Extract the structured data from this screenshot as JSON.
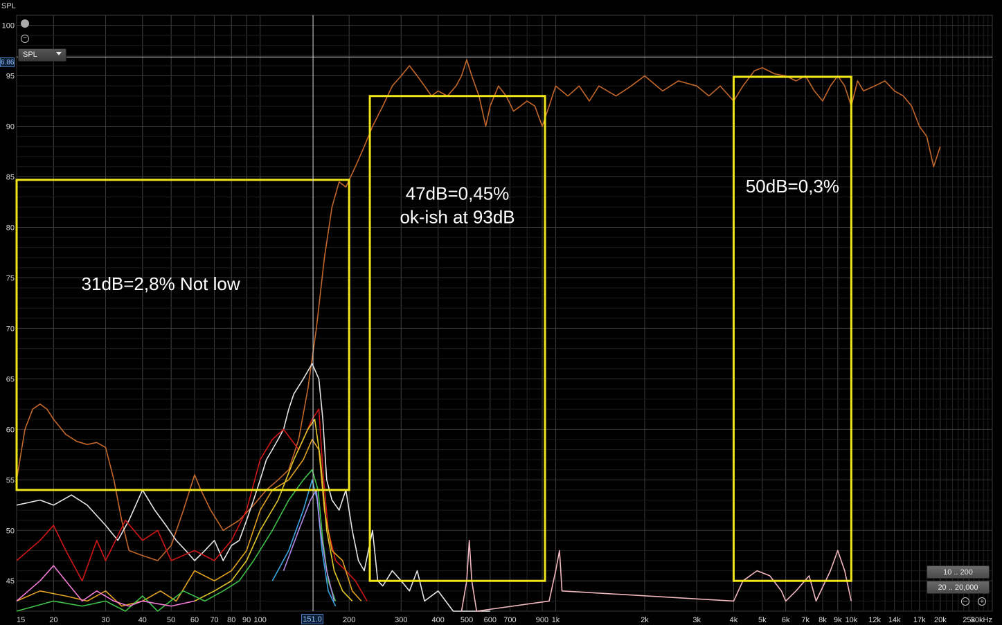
{
  "window": {
    "axis_title": "SPL"
  },
  "controls": {
    "dropdown_value": "SPL",
    "range_buttons": [
      "10 .. 200",
      "20 .. 20,000"
    ],
    "zoom_out_symbol": "−",
    "zoom_in_symbol": "+"
  },
  "cursor": {
    "y_readout": "6.86",
    "x_readout": "151.0",
    "x_value": 151.0,
    "y_value": 96.86
  },
  "annotations": [
    {
      "text_lines": [
        "31dB=2,8% Not low"
      ],
      "x_range": [
        15,
        200
      ],
      "y_range": [
        54,
        84.7
      ]
    },
    {
      "text_lines": [
        "47dB=0,45%",
        "ok-ish at 93dB"
      ],
      "x_range": [
        235,
        920
      ],
      "y_range": [
        45,
        93
      ]
    },
    {
      "text_lines": [
        "50dB=0,3%"
      ],
      "x_range": [
        4000,
        10000
      ],
      "y_range": [
        45,
        94.9
      ]
    }
  ],
  "colors": {
    "background": "#000000",
    "grid": "#3a3a3a",
    "highlight_box": "#f0e51a",
    "fundamental": "#c4672a",
    "total_distortion": "#e6e6e6",
    "h2": "#d01616",
    "h3": "#e3a21f",
    "h4": "#e4c92a",
    "h5": "#3ec24a",
    "h6": "#f07ad6",
    "h7": "#39a6e0",
    "h8": "#b08ae6",
    "h9": "#f2b8c0"
  },
  "chart_data": {
    "type": "line",
    "xscale": "log",
    "xlim": [
      15,
      30000
    ],
    "ylim": [
      42,
      101
    ],
    "xlabel": "",
    "ylabel": "SPL",
    "x_ticks": [
      15,
      20,
      30,
      40,
      50,
      60,
      70,
      80,
      90,
      100,
      200,
      300,
      400,
      500,
      600,
      700,
      900,
      1000,
      2000,
      3000,
      4000,
      5000,
      6000,
      7000,
      8000,
      9000,
      10000,
      12000,
      14000,
      17000,
      20000,
      25000,
      30000
    ],
    "x_tick_labels": [
      "15",
      "20",
      "30",
      "40",
      "50",
      "60",
      "70",
      "80",
      "90",
      "100",
      "200",
      "300",
      "400",
      "500",
      "600",
      "700",
      "900",
      "1k",
      "2k",
      "3k",
      "4k",
      "5k",
      "6k",
      "7k",
      "8k",
      "9k",
      "10k",
      "12k",
      "14k",
      "17k",
      "20k",
      "25k",
      "30kHz"
    ],
    "y_ticks": [
      45,
      50,
      55,
      60,
      65,
      70,
      75,
      80,
      85,
      90,
      95,
      100
    ],
    "grid": true,
    "series": [
      {
        "color_key": "fundamental",
        "points": [
          [
            15,
            55
          ],
          [
            16,
            60
          ],
          [
            17,
            62
          ],
          [
            18,
            62.5
          ],
          [
            19,
            62
          ],
          [
            20,
            61
          ],
          [
            22,
            59.5
          ],
          [
            24,
            58.8
          ],
          [
            26,
            58.5
          ],
          [
            28,
            58.7
          ],
          [
            30,
            58.2
          ],
          [
            32,
            55
          ],
          [
            34,
            51
          ],
          [
            36,
            48
          ],
          [
            40,
            47.5
          ],
          [
            45,
            47
          ],
          [
            50,
            48.5
          ],
          [
            55,
            52
          ],
          [
            60,
            55.5
          ],
          [
            63,
            54
          ],
          [
            68,
            52
          ],
          [
            75,
            50
          ],
          [
            85,
            51
          ],
          [
            95,
            52.5
          ],
          [
            105,
            54
          ],
          [
            115,
            55
          ],
          [
            125,
            56
          ],
          [
            135,
            59
          ],
          [
            145,
            64
          ],
          [
            155,
            70
          ],
          [
            165,
            77
          ],
          [
            175,
            82
          ],
          [
            185,
            84.5
          ],
          [
            195,
            84
          ],
          [
            210,
            86
          ],
          [
            225,
            88
          ],
          [
            240,
            90
          ],
          [
            260,
            92
          ],
          [
            280,
            94
          ],
          [
            300,
            95
          ],
          [
            320,
            96
          ],
          [
            340,
            95
          ],
          [
            360,
            94
          ],
          [
            380,
            93
          ],
          [
            400,
            93.5
          ],
          [
            430,
            93
          ],
          [
            460,
            94
          ],
          [
            480,
            95
          ],
          [
            500,
            96.6
          ],
          [
            520,
            95
          ],
          [
            550,
            93
          ],
          [
            580,
            90
          ],
          [
            600,
            92
          ],
          [
            640,
            94
          ],
          [
            680,
            93
          ],
          [
            720,
            91.5
          ],
          [
            760,
            92
          ],
          [
            800,
            92.5
          ],
          [
            850,
            92
          ],
          [
            900,
            90
          ],
          [
            950,
            92
          ],
          [
            1000,
            94
          ],
          [
            1100,
            93
          ],
          [
            1200,
            94
          ],
          [
            1300,
            92.5
          ],
          [
            1400,
            94
          ],
          [
            1600,
            93
          ],
          [
            1800,
            94
          ],
          [
            2000,
            95
          ],
          [
            2300,
            93.5
          ],
          [
            2600,
            94.5
          ],
          [
            3000,
            94
          ],
          [
            3300,
            93
          ],
          [
            3600,
            94
          ],
          [
            4000,
            92.5
          ],
          [
            4300,
            94
          ],
          [
            4700,
            95.5
          ],
          [
            5000,
            95.8
          ],
          [
            5500,
            95.2
          ],
          [
            6000,
            95
          ],
          [
            6500,
            94.5
          ],
          [
            7000,
            95
          ],
          [
            7500,
            93.5
          ],
          [
            8000,
            92.5
          ],
          [
            8500,
            94
          ],
          [
            9000,
            95
          ],
          [
            9500,
            94
          ],
          [
            10000,
            92
          ],
          [
            10500,
            94.5
          ],
          [
            11000,
            93.5
          ],
          [
            12000,
            94
          ],
          [
            13000,
            94.5
          ],
          [
            14000,
            93.5
          ],
          [
            15000,
            93
          ],
          [
            16000,
            92
          ],
          [
            17000,
            90
          ],
          [
            18000,
            89
          ],
          [
            19000,
            86
          ],
          [
            20000,
            88
          ]
        ]
      },
      {
        "color_key": "total_distortion",
        "points": [
          [
            15,
            52.5
          ],
          [
            18,
            53
          ],
          [
            20,
            52.5
          ],
          [
            23,
            53.5
          ],
          [
            26,
            52.5
          ],
          [
            30,
            50.5
          ],
          [
            33,
            49
          ],
          [
            36,
            51
          ],
          [
            40,
            54
          ],
          [
            44,
            52
          ],
          [
            48,
            50.5
          ],
          [
            52,
            49
          ],
          [
            56,
            48
          ],
          [
            60,
            47
          ],
          [
            65,
            48
          ],
          [
            70,
            49
          ],
          [
            75,
            47
          ],
          [
            80,
            48.5
          ],
          [
            85,
            49
          ],
          [
            90,
            51
          ],
          [
            95,
            53
          ],
          [
            100,
            55
          ],
          [
            105,
            57
          ],
          [
            110,
            58
          ],
          [
            115,
            59
          ],
          [
            120,
            60
          ],
          [
            125,
            62
          ],
          [
            130,
            63.5
          ],
          [
            140,
            65
          ],
          [
            150,
            66.5
          ],
          [
            158,
            65
          ],
          [
            163,
            61
          ],
          [
            168,
            55
          ],
          [
            175,
            53
          ],
          [
            185,
            52
          ],
          [
            195,
            54
          ],
          [
            205,
            50
          ],
          [
            215,
            47
          ],
          [
            225,
            46
          ],
          [
            240,
            50
          ],
          [
            250,
            45
          ],
          [
            260,
            44.5
          ],
          [
            280,
            46
          ],
          [
            300,
            45
          ],
          [
            320,
            44
          ],
          [
            340,
            46
          ],
          [
            360,
            43
          ],
          [
            400,
            44
          ],
          [
            450,
            42
          ],
          [
            500,
            41
          ],
          [
            600,
            40
          ]
        ]
      },
      {
        "color_key": "h2",
        "points": [
          [
            15,
            47
          ],
          [
            18,
            49
          ],
          [
            20,
            50.5
          ],
          [
            22,
            48
          ],
          [
            25,
            45
          ],
          [
            28,
            49
          ],
          [
            30,
            47
          ],
          [
            35,
            51
          ],
          [
            40,
            49
          ],
          [
            45,
            50
          ],
          [
            50,
            47
          ],
          [
            60,
            48
          ],
          [
            70,
            47
          ],
          [
            80,
            49
          ],
          [
            90,
            52
          ],
          [
            100,
            57
          ],
          [
            110,
            59
          ],
          [
            120,
            60
          ],
          [
            135,
            58
          ],
          [
            150,
            61
          ],
          [
            158,
            62
          ],
          [
            163,
            56
          ],
          [
            170,
            50
          ],
          [
            180,
            47
          ],
          [
            195,
            46
          ],
          [
            210,
            45
          ],
          [
            230,
            43
          ]
        ]
      },
      {
        "color_key": "h3",
        "points": [
          [
            15,
            43
          ],
          [
            18,
            44
          ],
          [
            22,
            43.5
          ],
          [
            26,
            43
          ],
          [
            30,
            44
          ],
          [
            34,
            42.5
          ],
          [
            40,
            43
          ],
          [
            46,
            44
          ],
          [
            52,
            43
          ],
          [
            60,
            46
          ],
          [
            70,
            45
          ],
          [
            80,
            46
          ],
          [
            90,
            48
          ],
          [
            100,
            52
          ],
          [
            110,
            54
          ],
          [
            125,
            55
          ],
          [
            140,
            57
          ],
          [
            150,
            59
          ],
          [
            158,
            58
          ],
          [
            165,
            52
          ],
          [
            175,
            48
          ],
          [
            190,
            47
          ],
          [
            205,
            44
          ],
          [
            220,
            43
          ]
        ]
      },
      {
        "color_key": "h4",
        "points": [
          [
            60,
            43
          ],
          [
            70,
            44
          ],
          [
            80,
            45
          ],
          [
            90,
            47
          ],
          [
            100,
            50
          ],
          [
            115,
            53
          ],
          [
            130,
            57
          ],
          [
            145,
            60
          ],
          [
            153,
            61
          ],
          [
            160,
            57
          ],
          [
            168,
            50
          ],
          [
            178,
            46
          ],
          [
            190,
            44
          ],
          [
            205,
            43
          ]
        ]
      },
      {
        "color_key": "h5",
        "points": [
          [
            15,
            42
          ],
          [
            20,
            43
          ],
          [
            25,
            42.5
          ],
          [
            30,
            43
          ],
          [
            35,
            42
          ],
          [
            40,
            43.5
          ],
          [
            45,
            42
          ],
          [
            55,
            44
          ],
          [
            65,
            43
          ],
          [
            75,
            44
          ],
          [
            85,
            45
          ],
          [
            95,
            47
          ],
          [
            110,
            50
          ],
          [
            125,
            53
          ],
          [
            140,
            55
          ],
          [
            150,
            56
          ],
          [
            157,
            54
          ],
          [
            163,
            49
          ],
          [
            170,
            45
          ],
          [
            180,
            43
          ]
        ]
      },
      {
        "color_key": "h6",
        "points": [
          [
            15,
            43
          ],
          [
            18,
            45
          ],
          [
            20,
            46.5
          ],
          [
            22,
            45
          ],
          [
            25,
            43
          ],
          [
            28,
            44
          ],
          [
            32,
            43
          ],
          [
            36,
            42.5
          ],
          [
            40,
            43
          ],
          [
            50,
            42.5
          ],
          [
            60,
            43
          ]
        ]
      },
      {
        "color_key": "h7",
        "points": [
          [
            110,
            45
          ],
          [
            125,
            48
          ],
          [
            140,
            52
          ],
          [
            150,
            55
          ],
          [
            156,
            53
          ],
          [
            162,
            48
          ],
          [
            170,
            44
          ],
          [
            180,
            42.5
          ]
        ]
      },
      {
        "color_key": "h8",
        "points": [
          [
            120,
            46
          ],
          [
            135,
            50
          ],
          [
            148,
            53
          ],
          [
            155,
            54
          ],
          [
            160,
            50
          ],
          [
            168,
            46
          ],
          [
            178,
            43
          ]
        ]
      },
      {
        "color_key": "h9",
        "points": [
          [
            480,
            42
          ],
          [
            500,
            45
          ],
          [
            510,
            49
          ],
          [
            520,
            45
          ],
          [
            540,
            42
          ],
          [
            950,
            43
          ],
          [
            1000,
            46
          ],
          [
            1030,
            48
          ],
          [
            1050,
            44
          ],
          [
            4000,
            43
          ],
          [
            4300,
            45
          ],
          [
            4800,
            46
          ],
          [
            5300,
            45.5
          ],
          [
            5800,
            44
          ],
          [
            6000,
            43
          ],
          [
            6500,
            44
          ],
          [
            7200,
            45.5
          ],
          [
            7600,
            43
          ],
          [
            8500,
            46
          ],
          [
            9000,
            48
          ],
          [
            9500,
            46
          ],
          [
            10000,
            43
          ]
        ]
      }
    ]
  }
}
